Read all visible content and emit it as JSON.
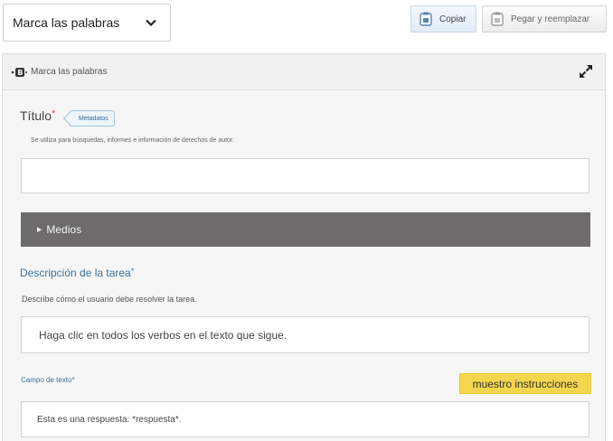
{
  "toolbar": {
    "selector_value": "Marca las palabras",
    "copy_label": "Copiar",
    "paste_label": "Pegar y reemplazar"
  },
  "panel": {
    "header_title": "Marca las palabras",
    "title_label": "Título",
    "required_mark": "*",
    "metadata_label": "Metadatos",
    "title_help": "Se utiliza para búsquedas, informes e información de derechos de autor.",
    "title_value": "",
    "media_label": "Medios",
    "description_label": "Descripción de la tarea",
    "description_help": "Describe cómo el usuario debe resolver la tarea.",
    "description_value": "Haga clic en todos los verbos en el texto que sigue.",
    "text_field_label": "Campo de texto",
    "instructions_button": "muestro instrucciones",
    "text_field_value": "Esta es una respuesta: *respuesta*."
  },
  "icons": {
    "selector": "chevron-down-icon",
    "copy": "clipboard-icon",
    "paste": "clipboard-paste-icon",
    "header": "library-icon",
    "expand": "expand-icon",
    "media": "triangle-right-icon"
  },
  "colors": {
    "accent_blue": "#3e6f9a",
    "media_bar": "#6d6b6b",
    "instructions_button": "#f3d64d"
  }
}
